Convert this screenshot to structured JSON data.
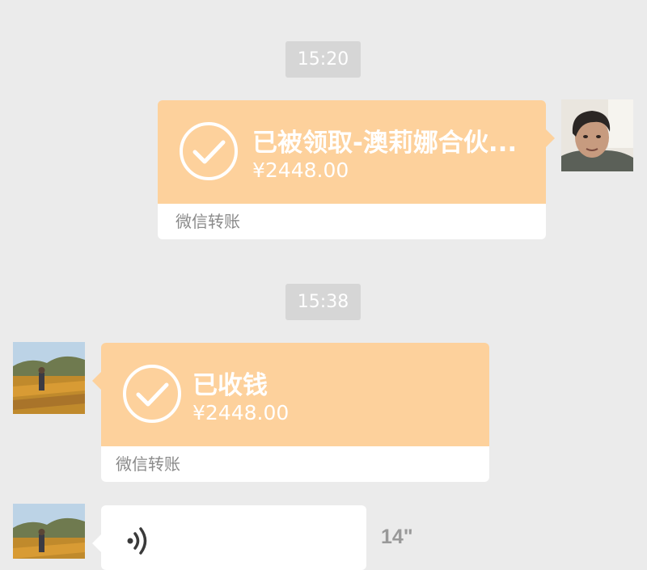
{
  "chat": {
    "time1": "15:20",
    "transfer1": {
      "title": "已被领取-澳莉娜合伙...",
      "amount": "¥2448.00",
      "footer": "微信转账"
    },
    "time2": "15:38",
    "transfer2": {
      "title": "已收钱",
      "amount": "¥2448.00",
      "footer": "微信转账"
    },
    "voice": {
      "duration": "14\""
    }
  },
  "colors": {
    "background": "#ebebeb",
    "transfer_bubble": "#fdd19c",
    "timestamp_bg": "#d6d6d6"
  },
  "icons": [
    "check-circle-icon",
    "voice-wave-icon"
  ]
}
